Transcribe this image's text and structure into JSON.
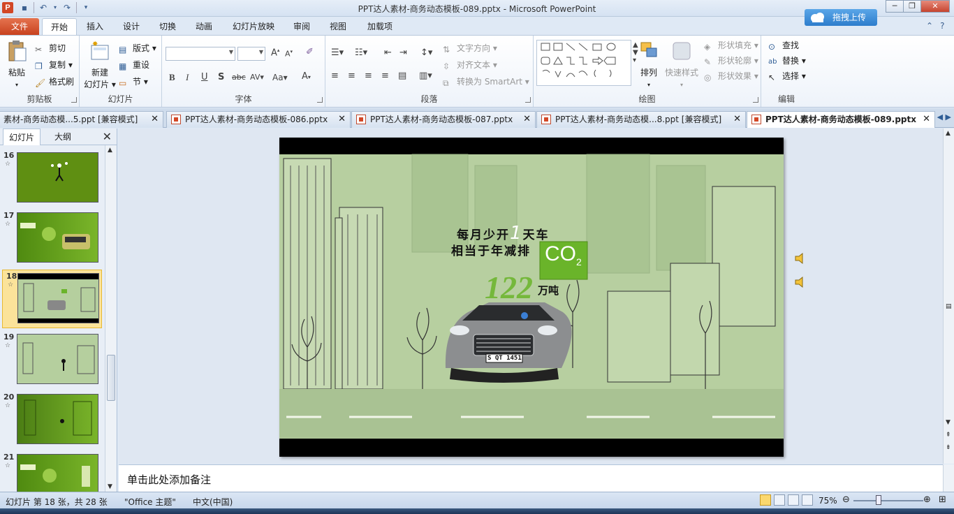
{
  "window": {
    "title": "PPT达人素材-商务动态模板-089.pptx - Microsoft PowerPoint",
    "app_icon": "P"
  },
  "quick_access": {
    "icons": [
      "save-icon",
      "undo-icon",
      "redo-icon",
      "customize-icon"
    ]
  },
  "ribbon_tabs": [
    "文件",
    "开始",
    "插入",
    "设计",
    "切换",
    "动画",
    "幻灯片放映",
    "审阅",
    "视图",
    "加载项"
  ],
  "active_tab": "开始",
  "upload_button": "拖拽上传",
  "clipboard": {
    "paste": "粘贴",
    "cut": "剪切",
    "copy": "复制",
    "format_painter": "格式刷",
    "label": "剪贴板"
  },
  "slides_group": {
    "new_slide": "新建",
    "new_slide2": "幻灯片",
    "layout": "版式",
    "reset": "重设",
    "section": "节",
    "label": "幻灯片"
  },
  "font_group": {
    "label": "字体"
  },
  "paragraph_group": {
    "text_direction": "文字方向",
    "align_text": "对齐文本",
    "smartart": "转换为 SmartArt",
    "label": "段落"
  },
  "drawing_group": {
    "arrange": "排列",
    "quick_styles": "快速样式",
    "shape_fill": "形状填充",
    "shape_outline": "形状轮廓",
    "shape_effects": "形状效果",
    "label": "绘图"
  },
  "editing_group": {
    "find": "查找",
    "replace": "替换",
    "select": "选择",
    "label": "编辑"
  },
  "doc_tabs": [
    {
      "label": "素材-商务动态模...5.ppt [兼容模式]",
      "active": false
    },
    {
      "label": "PPT达人素材-商务动态模板-086.pptx",
      "active": false
    },
    {
      "label": "PPT达人素材-商务动态模板-087.pptx",
      "active": false
    },
    {
      "label": "PPT达人素材-商务动态模...8.ppt [兼容模式]",
      "active": false
    },
    {
      "label": "PPT达人素材-商务动态模板-089.pptx",
      "active": true
    }
  ],
  "left_pane": {
    "tabs": [
      "幻灯片",
      "大纲"
    ],
    "thumbnails": [
      {
        "num": "16",
        "selected": false
      },
      {
        "num": "17",
        "selected": false
      },
      {
        "num": "18",
        "selected": true
      },
      {
        "num": "19",
        "selected": false
      },
      {
        "num": "20",
        "selected": false
      },
      {
        "num": "21",
        "selected": false
      }
    ]
  },
  "slide": {
    "line1_a": "每月少开",
    "line1_num": "1",
    "line1_b": "天车",
    "line2": "相当于年减排",
    "co2": "CO",
    "co2_sub": "2",
    "big_number": "122",
    "unit": "万吨",
    "plate": "S QT 1451"
  },
  "notes": {
    "placeholder": "单击此处添加备注"
  },
  "status": {
    "slide_info": "幻灯片 第 18 张，共 28 张",
    "theme": "\"Office 主题\"",
    "language": "中文(中国)",
    "zoom": "75%"
  },
  "colors": {
    "accent": "#d24726",
    "slide_green": "#b5cf9e",
    "co2_green": "#6ab42a"
  }
}
